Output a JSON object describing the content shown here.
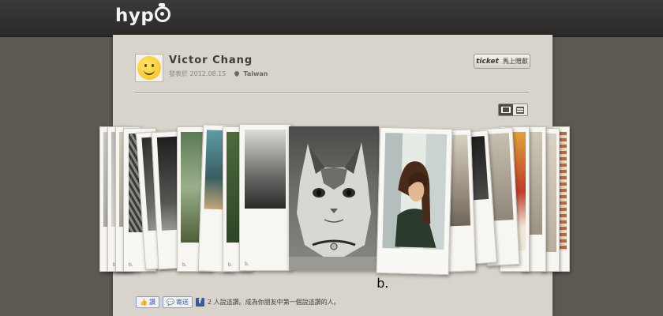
{
  "header": {
    "logo_text": "hyp"
  },
  "post": {
    "author": "Victor Chang",
    "published_label": "發表於 2012.08.15",
    "location": "Taiwan",
    "ticket_brand": "ticket",
    "ticket_action": "馬上贈獻"
  },
  "photos": {
    "watermark": "b."
  },
  "footer": {
    "like_label": "讚",
    "send_label": "寄送",
    "like_text": "2 人說這讚。成為你朋友中第一個說這讚的人。"
  },
  "colors": {
    "topbar": "#2f2e2c",
    "background": "#5c5852",
    "panel": "#d8d4cb",
    "facebook": "#3b5998"
  }
}
